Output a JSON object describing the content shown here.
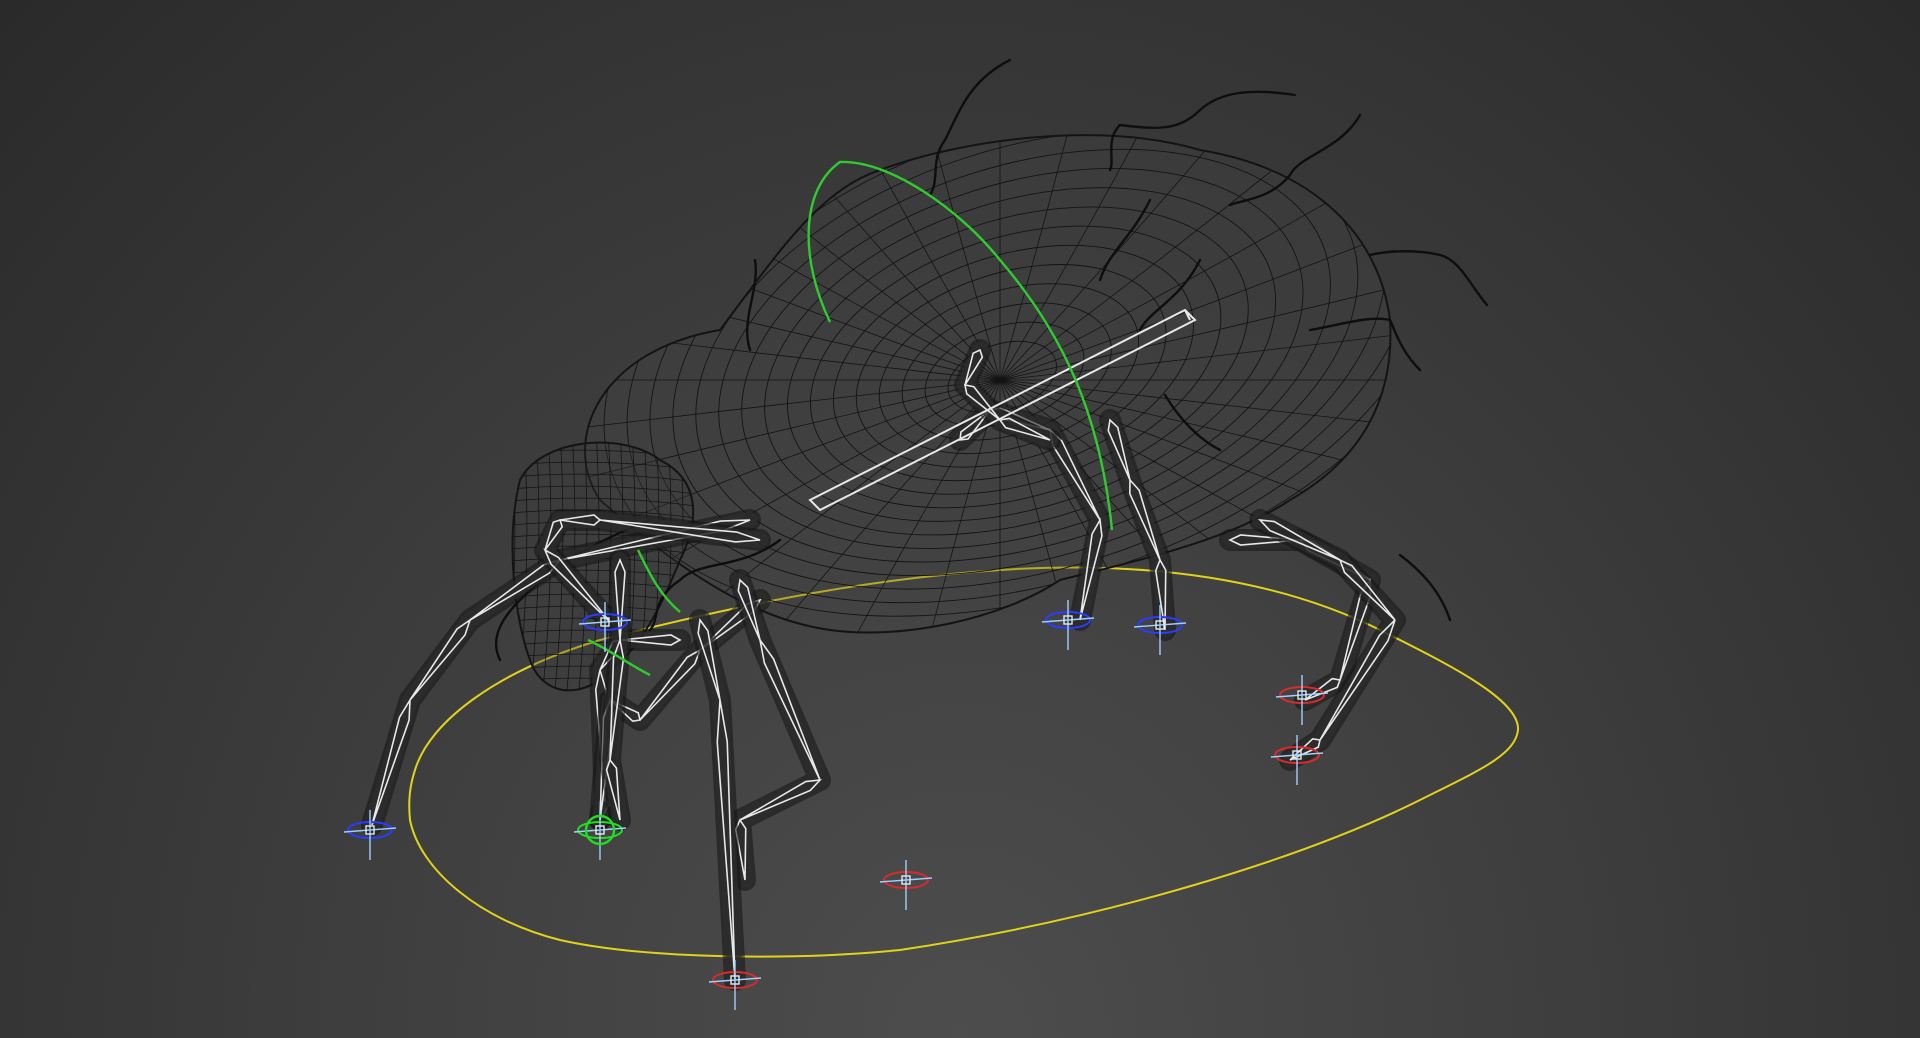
{
  "viewport": {
    "mode": "wireframe",
    "background_color": "#3a3a3a",
    "subject": "rigged-mite-model"
  },
  "colors": {
    "mesh_wire": "#141414",
    "bone_wire": "#e6e8ea",
    "hair_strands": "#0e0e0e",
    "spline_ground": "#e2d21a",
    "spline_green": "#2ecc2e",
    "ik_target_blue": "#2a3cff",
    "ik_target_red": "#d92b2b",
    "ik_target_green": "#22dd22",
    "axis_tripod": "#9fd0ff"
  },
  "ik_targets": [
    {
      "id": "foot-left-front",
      "tint": "blue"
    },
    {
      "id": "foot-left-mid",
      "tint": "blue"
    },
    {
      "id": "foot-center-a",
      "tint": "blue"
    },
    {
      "id": "foot-center-b",
      "tint": "blue"
    },
    {
      "id": "foot-right-a",
      "tint": "red"
    },
    {
      "id": "foot-right-b",
      "tint": "red"
    },
    {
      "id": "foot-front-a",
      "tint": "red"
    },
    {
      "id": "foot-front-b",
      "tint": "red"
    },
    {
      "id": "mouth-control",
      "tint": "green"
    }
  ]
}
